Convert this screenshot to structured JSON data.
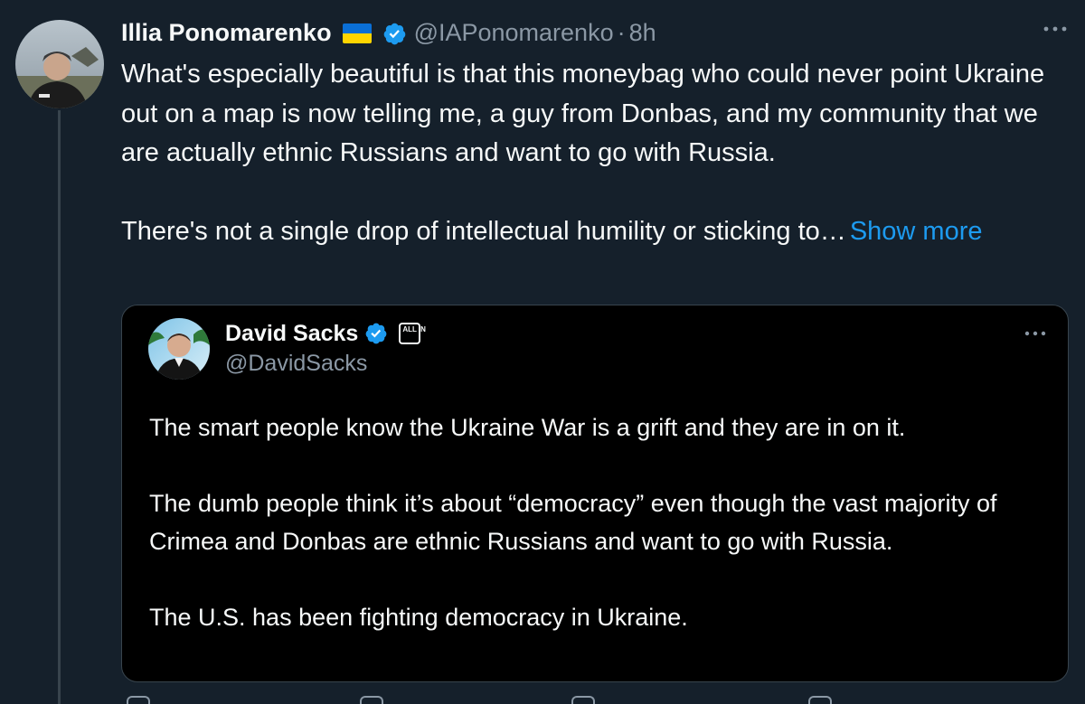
{
  "tweet": {
    "author": {
      "display_name": "Illia Ponomarenko",
      "flag": "ukraine-flag",
      "verified": true,
      "handle": "@IAPonomarenko",
      "separator": "·",
      "time": "8h"
    },
    "paragraphs": [
      "What's especially beautiful is that this moneybag who could never point Ukraine out on a map is now telling me, a guy from Donbas, and my community that we are actually ethnic Russians and want to go with Russia.",
      "There's not a single drop of intellectual humility or sticking to…"
    ],
    "show_more_label": "Show more",
    "more_icon": "more-dots-icon"
  },
  "quoted_tweet": {
    "author": {
      "display_name": "David Sacks",
      "verified": true,
      "badge_text": "ALL IN",
      "handle": "@DavidSacks"
    },
    "paragraphs": [
      "The smart people know the Ukraine War is a grift and they are in on it.",
      "The dumb people think it’s about “democracy” even though the vast majority of Crimea and Donbas are ethnic Russians and want to go with Russia.",
      "The U.S. has been fighting democracy in Ukraine."
    ],
    "more_icon": "more-dots-icon"
  },
  "colors": {
    "background": "#15202b",
    "quote_background": "#000000",
    "text_primary": "#f7f9f9",
    "text_secondary": "#8b98a5",
    "link": "#1d9bf0",
    "verified": "#1d9bf0",
    "border": "#38444d"
  }
}
